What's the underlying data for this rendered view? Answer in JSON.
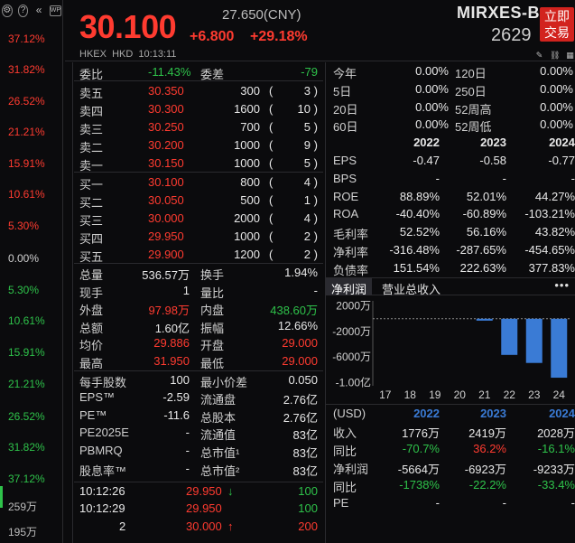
{
  "scale": {
    "rows": [
      {
        "text": "37.12%",
        "color": "#ff3b30",
        "y": 44
      },
      {
        "text": "31.82%",
        "color": "#ff3b30",
        "y": 78
      },
      {
        "text": "26.52%",
        "color": "#ff3b30",
        "y": 113
      },
      {
        "text": "21.21%",
        "color": "#ff3b30",
        "y": 147
      },
      {
        "text": "15.91%",
        "color": "#ff3b30",
        "y": 182
      },
      {
        "text": "10.61%",
        "color": "#ff3b30",
        "y": 216
      },
      {
        "text": "5.30%",
        "color": "#ff3b30",
        "y": 251
      },
      {
        "text": "0.00%",
        "color": "#cfcfcf",
        "y": 287
      },
      {
        "text": "5.30%",
        "color": "#2ec24a",
        "y": 322
      },
      {
        "text": "10.61%",
        "color": "#2ec24a",
        "y": 356
      },
      {
        "text": "15.91%",
        "color": "#2ec24a",
        "y": 391
      },
      {
        "text": "21.21%",
        "color": "#2ec24a",
        "y": 426
      },
      {
        "text": "26.52%",
        "color": "#2ec24a",
        "y": 462
      },
      {
        "text": "31.82%",
        "color": "#2ec24a",
        "y": 496
      },
      {
        "text": "37.12%",
        "color": "#2ec24a",
        "y": 531
      },
      {
        "text": "259万",
        "color": "#bdbdbd",
        "y": 560
      },
      {
        "text": "195万",
        "color": "#bdbdbd",
        "y": 588
      }
    ]
  },
  "header": {
    "price": "30.100",
    "price_cny": "27.650(CNY)",
    "change": "+6.800",
    "change_pct": "+29.18%",
    "exchange_line": "HKEX  HKD  10:13:11",
    "name": "MIRXES-B",
    "code": "2629",
    "trade_button": "立即\n交易"
  },
  "book": {
    "wei_bi_label": "委比",
    "wei_bi": "-11.43%",
    "wei_cha_label": "委差",
    "wei_cha": "-79",
    "asks": [
      {
        "label": "卖五",
        "price": "30.350",
        "vol": "300",
        "n": "3"
      },
      {
        "label": "卖四",
        "price": "30.300",
        "vol": "1600",
        "n": "10"
      },
      {
        "label": "卖三",
        "price": "30.250",
        "vol": "700",
        "n": "5"
      },
      {
        "label": "卖二",
        "price": "30.200",
        "vol": "1000",
        "n": "9"
      },
      {
        "label": "卖一",
        "price": "30.150",
        "vol": "1000",
        "n": "5"
      }
    ],
    "bids": [
      {
        "label": "买一",
        "price": "30.100",
        "vol": "800",
        "n": "4"
      },
      {
        "label": "买二",
        "price": "30.050",
        "vol": "500",
        "n": "1"
      },
      {
        "label": "买三",
        "price": "30.000",
        "vol": "2000",
        "n": "4"
      },
      {
        "label": "买四",
        "price": "29.950",
        "vol": "1000",
        "n": "2"
      },
      {
        "label": "买五",
        "price": "29.900",
        "vol": "1200",
        "n": "2"
      }
    ]
  },
  "stats": {
    "rows": [
      {
        "l1": "总量",
        "v1": "536.57万",
        "c1": "#e8e8e8",
        "l2": "换手",
        "v2": "1.94%",
        "c2": "#e8e8e8"
      },
      {
        "l1": "现手",
        "v1": "1",
        "c1": "#e8e8e8",
        "l2": "量比",
        "v2": "-",
        "c2": "#e8e8e8"
      },
      {
        "l1": "外盘",
        "v1": "97.98万",
        "c1": "#ff3b30",
        "l2": "内盘",
        "v2": "438.60万",
        "c2": "#2ec24a"
      },
      {
        "l1": "总额",
        "v1": "1.60亿",
        "c1": "#e8e8e8",
        "l2": "振幅",
        "v2": "12.66%",
        "c2": "#e8e8e8"
      },
      {
        "l1": "均价",
        "v1": "29.886",
        "c1": "#ff3b30",
        "l2": "开盘",
        "v2": "29.000",
        "c2": "#ff3b30"
      },
      {
        "l1": "最高",
        "v1": "31.950",
        "c1": "#ff3b30",
        "l2": "最低",
        "v2": "29.000",
        "c2": "#ff3b30"
      },
      {
        "l1": "每手股数",
        "v1": "100",
        "c1": "#e8e8e8",
        "l2": "最小价差",
        "v2": "0.050",
        "c2": "#e8e8e8"
      },
      {
        "l1": "EPS™",
        "v1": "-2.59",
        "c1": "#e8e8e8",
        "l2": "流通盘",
        "v2": "2.76亿",
        "c2": "#e8e8e8"
      },
      {
        "l1": "PE™",
        "v1": "-11.6",
        "c1": "#e8e8e8",
        "l2": "总股本",
        "v2": "2.76亿",
        "c2": "#e8e8e8"
      },
      {
        "l1": "PE2025E",
        "v1": "-",
        "c1": "#e8e8e8",
        "l2": "流通值",
        "v2": "83亿",
        "c2": "#e8e8e8"
      },
      {
        "l1": "PBMRQ",
        "v1": "-",
        "c1": "#e8e8e8",
        "l2": "总市值¹",
        "v2": "83亿",
        "c2": "#e8e8e8"
      },
      {
        "l1": "股息率™",
        "v1": "-",
        "c1": "#e8e8e8",
        "l2": "总市值²",
        "v2": "83亿",
        "c2": "#e8e8e8"
      }
    ]
  },
  "ticks": [
    {
      "time": "10:12:26",
      "price": "29.950",
      "arrow": "↓",
      "arrow_color": "#2ec24a",
      "vol": "100",
      "vol_color": "#2ec24a"
    },
    {
      "time": "10:12:29",
      "price": "29.950",
      "arrow": "",
      "arrow_color": "#2ec24a",
      "vol": "100",
      "vol_color": "#2ec24a"
    },
    {
      "time": "2",
      "price": "30.000",
      "arrow": "↑",
      "arrow_color": "#ff3b30",
      "vol": "200",
      "vol_color": "#ff3b30"
    }
  ],
  "right": {
    "returns": [
      {
        "l1": "今年",
        "v1": "0.00%",
        "l2": "120日",
        "v2": "0.00%"
      },
      {
        "l1": "5日",
        "v1": "0.00%",
        "l2": "250日",
        "v2": "0.00%"
      },
      {
        "l1": "20日",
        "v1": "0.00%",
        "l2": "52周高",
        "v2": "0.00%"
      },
      {
        "l1": "60日",
        "v1": "0.00%",
        "l2": "52周低",
        "v2": "0.00%"
      }
    ],
    "years": [
      "2022",
      "2023",
      "2024"
    ],
    "metrics": [
      {
        "label": "EPS",
        "vals": [
          "-0.47",
          "-0.58",
          "-0.77"
        ]
      },
      {
        "label": "BPS",
        "vals": [
          "-",
          "-",
          "-"
        ]
      },
      {
        "label": "ROE",
        "vals": [
          "88.89%",
          "52.01%",
          "44.27%"
        ]
      },
      {
        "label": "ROA",
        "vals": [
          "-40.40%",
          "-60.89%",
          "-103.21%"
        ]
      },
      {
        "label": "毛利率",
        "vals": [
          "52.52%",
          "56.16%",
          "43.82%"
        ]
      },
      {
        "label": "净利率",
        "vals": [
          "-316.48%",
          "-287.65%",
          "-454.65%"
        ]
      },
      {
        "label": "负债率",
        "vals": [
          "151.54%",
          "222.63%",
          "377.83%"
        ]
      }
    ],
    "tab_active": "净利润",
    "tab_other": "营业总收入",
    "more": "•••",
    "fin_header": "(USD)",
    "fin_rows": [
      {
        "label": "收入",
        "vals": [
          "1776万",
          "2419万",
          "2028万"
        ],
        "colors": [
          "#e8e8e8",
          "#e8e8e8",
          "#e8e8e8"
        ]
      },
      {
        "label": "同比",
        "vals": [
          "-70.7%",
          "36.2%",
          "-16.1%"
        ],
        "colors": [
          "#2ec24a",
          "#ff3b30",
          "#2ec24a"
        ]
      },
      {
        "label": "净利润",
        "vals": [
          "-5664万",
          "-6923万",
          "-9233万"
        ],
        "colors": [
          "#e8e8e8",
          "#e8e8e8",
          "#e8e8e8"
        ]
      },
      {
        "label": "同比",
        "vals": [
          "-1738%",
          "-22.2%",
          "-33.4%"
        ],
        "colors": [
          "#2ec24a",
          "#2ec24a",
          "#2ec24a"
        ]
      },
      {
        "label": "PE",
        "vals": [
          "-",
          "-",
          "-"
        ],
        "colors": [
          "#e8e8e8",
          "#e8e8e8",
          "#e8e8e8"
        ]
      }
    ]
  },
  "chart_data": {
    "type": "bar",
    "categories": [
      "17",
      "18",
      "19",
      "20",
      "21",
      "22",
      "23",
      "24"
    ],
    "values": [
      0,
      0,
      0,
      0,
      -300,
      -5664,
      -6923,
      -9233
    ],
    "ytick_labels": [
      "2000万",
      "-2000万",
      "-6000万",
      "-1.00亿"
    ],
    "yticks": [
      2000,
      -2000,
      -6000,
      -10000
    ],
    "ylim": [
      -10500,
      2800
    ],
    "bar_color": "#3a7bd5"
  }
}
